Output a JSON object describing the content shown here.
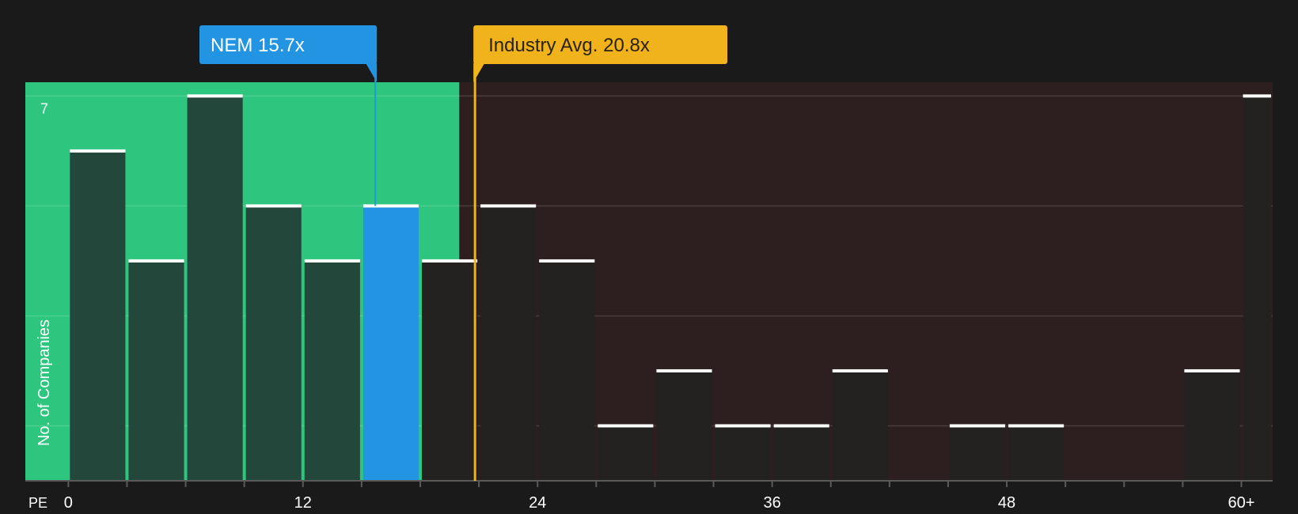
{
  "chart_data": {
    "type": "bar",
    "xlabel": "PE",
    "ylabel": "No. of Companies",
    "x_ticks": [
      {
        "value": 0,
        "label": "0"
      },
      {
        "value": 12,
        "label": "12"
      },
      {
        "value": 24,
        "label": "24"
      },
      {
        "value": 36,
        "label": "36"
      },
      {
        "value": 48,
        "label": "48"
      },
      {
        "value": 60,
        "label": "60+"
      }
    ],
    "y_tick_labels": [
      {
        "value": 7,
        "label": "7"
      }
    ],
    "ylim": [
      0,
      7.25
    ],
    "xlim": [
      -2.2,
      61.6
    ],
    "bin_width": 3,
    "grid": true,
    "bins": [
      {
        "start": 0,
        "count": 6
      },
      {
        "start": 3,
        "count": 4
      },
      {
        "start": 6,
        "count": 7
      },
      {
        "start": 9,
        "count": 5
      },
      {
        "start": 12,
        "count": 4
      },
      {
        "start": 15,
        "count": 5,
        "highlight": true
      },
      {
        "start": 18,
        "count": 4
      },
      {
        "start": 21,
        "count": 5
      },
      {
        "start": 24,
        "count": 4
      },
      {
        "start": 27,
        "count": 1
      },
      {
        "start": 30,
        "count": 2
      },
      {
        "start": 33,
        "count": 1
      },
      {
        "start": 36,
        "count": 1
      },
      {
        "start": 39,
        "count": 2
      },
      {
        "start": 42,
        "count": 0
      },
      {
        "start": 45,
        "count": 1
      },
      {
        "start": 48,
        "count": 1
      },
      {
        "start": 51,
        "count": 0
      },
      {
        "start": 54,
        "count": 0
      },
      {
        "start": 57,
        "count": 2
      },
      {
        "start": 60,
        "count": 7
      }
    ],
    "company": {
      "label": "NEM 15.7x",
      "value": 15.7
    },
    "industry_avg": {
      "label": "Industry Avg. 20.8x",
      "value": 20.8
    },
    "fair_region_end": 20.0,
    "colors": {
      "background": "#1a1a1a",
      "fair_zone": "#2ec67e",
      "fair_bar": "#23473a",
      "expensive_zone": "#2d1e1f",
      "expensive_bar": "#242121",
      "highlight_bar": "#2394e1",
      "company_label_bg": "#2394e1",
      "industry_label_bg": "#f0b31b",
      "cap": "#ffffff",
      "text": "#ffffff",
      "industry_text": "#2a2112"
    }
  }
}
